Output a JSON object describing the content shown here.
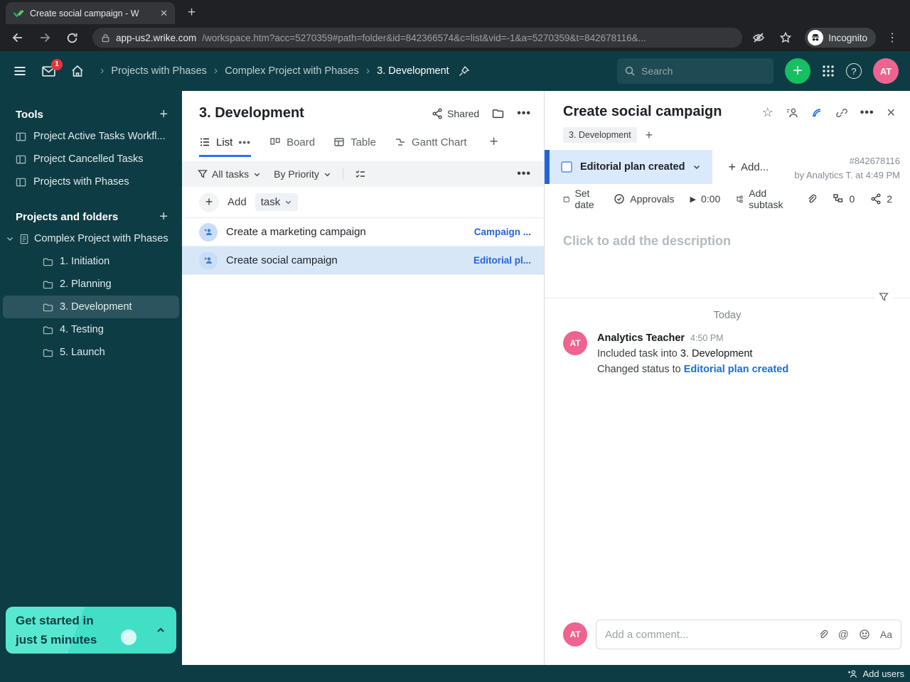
{
  "browser": {
    "tab_title": "Create social campaign - W",
    "url_host": "app-us2.wrike.com",
    "url_path": "/workspace.htm?acc=5270359#path=folder&id=842366574&c=list&vid=-1&a=5270359&t=842678116&...",
    "incognito_label": "Incognito"
  },
  "header": {
    "inbox_badge": "1",
    "breadcrumbs": [
      "Projects with Phases",
      "Complex Project with Phases",
      "3. Development"
    ],
    "search_placeholder": "Search"
  },
  "sidebar": {
    "tools_title": "Tools",
    "tools": [
      "Project Active Tasks Workfl...",
      "Project Cancelled Tasks",
      "Projects with Phases"
    ],
    "projects_title": "Projects and folders",
    "project_root": "Complex Project with Phases",
    "phases": [
      "1. Initiation",
      "2. Planning",
      "3. Development",
      "4. Testing",
      "5. Launch"
    ],
    "promo_line1": "Get started in",
    "promo_line2": "just 5 minutes"
  },
  "list_panel": {
    "title": "3. Development",
    "shared_label": "Shared",
    "tabs": [
      "List",
      "Board",
      "Table",
      "Gantt Chart"
    ],
    "filters": {
      "scope": "All tasks",
      "sort": "By Priority"
    },
    "add_label": "Add",
    "add_type": "task",
    "tasks": [
      {
        "title": "Create a marketing campaign",
        "status": "Campaign ..."
      },
      {
        "title": "Create social campaign",
        "status": "Editorial pl..."
      }
    ]
  },
  "detail_panel": {
    "title": "Create social campaign",
    "tag": "3. Development",
    "status": "Editorial plan created",
    "add_more_label": "Add...",
    "task_id": "#842678116",
    "byline": "by Analytics T. at 4:49 PM",
    "toolbar": {
      "set_date": "Set date",
      "approvals": "Approvals",
      "timer": "0:00",
      "add_subtask": "Add subtask",
      "dependency_count": "0",
      "share_count": "2"
    },
    "description_placeholder": "Click to add the description",
    "stream_day": "Today",
    "activity": {
      "author": "Analytics Teacher",
      "time": "4:50 PM",
      "line1_prefix": "Included task into ",
      "line1_target": "3. Development",
      "line2_prefix": "Changed status to ",
      "line2_status": "Editorial plan created"
    },
    "avatar_initials": "AT",
    "comment_placeholder": "Add a comment...",
    "format_label": "Aa"
  },
  "footer": {
    "add_users_label": "Add users"
  }
}
